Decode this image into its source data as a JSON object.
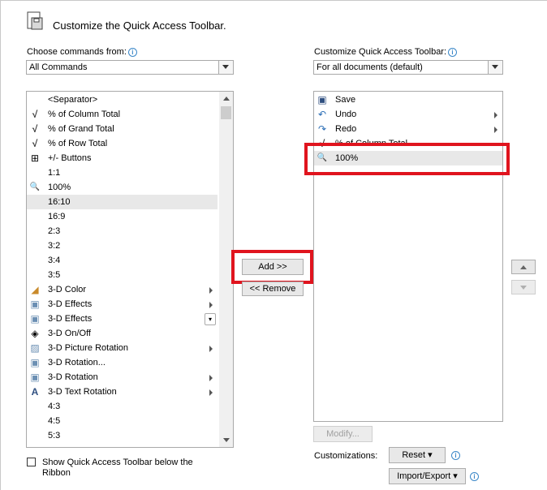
{
  "header": {
    "title": "Customize the Quick Access Toolbar."
  },
  "left_panel": {
    "label": "Choose commands from:",
    "combo_value": "All Commands",
    "items": [
      {
        "label": "<Separator>",
        "icon": "none"
      },
      {
        "label": "% of Column Total",
        "icon": "checkmark-icon"
      },
      {
        "label": "% of Grand Total",
        "icon": "checkmark-icon"
      },
      {
        "label": "% of Row Total",
        "icon": "checkmark-icon"
      },
      {
        "label": "+/- Buttons",
        "icon": "plus-minus-icon"
      },
      {
        "label": "1:1",
        "icon": "none"
      },
      {
        "label": "100%",
        "icon": "zoom-100-icon"
      },
      {
        "label": "16:10",
        "icon": "none",
        "selected": true
      },
      {
        "label": "16:9",
        "icon": "none"
      },
      {
        "label": "2:3",
        "icon": "none"
      },
      {
        "label": "3:2",
        "icon": "none"
      },
      {
        "label": "3:4",
        "icon": "none"
      },
      {
        "label": "3:5",
        "icon": "none"
      },
      {
        "label": "3-D Color",
        "icon": "paint-bucket-icon",
        "submenu": true
      },
      {
        "label": "3-D Effects",
        "icon": "cube-icon",
        "submenu": true
      },
      {
        "label": "3-D Effects",
        "icon": "cube-icon",
        "dropdown": true
      },
      {
        "label": "3-D On/Off",
        "icon": "shapes-icon"
      },
      {
        "label": "3-D Picture Rotation",
        "icon": "picture-rotate-icon",
        "submenu": true
      },
      {
        "label": "3-D Rotation...",
        "icon": "cube-icon"
      },
      {
        "label": "3-D Rotation",
        "icon": "cube-icon",
        "submenu": true
      },
      {
        "label": "3-D Text Rotation",
        "icon": "text-a-icon",
        "submenu": true
      },
      {
        "label": "4:3",
        "icon": "none"
      },
      {
        "label": "4:5",
        "icon": "none"
      },
      {
        "label": "5:3",
        "icon": "none"
      }
    ],
    "checkbox_label": "Show Quick Access Toolbar below the Ribbon"
  },
  "right_panel": {
    "label": "Customize Quick Access Toolbar:",
    "combo_value": "For all documents (default)",
    "items": [
      {
        "label": "Save",
        "icon": "floppy-icon"
      },
      {
        "label": "Undo",
        "icon": "undo-icon",
        "submenu": true
      },
      {
        "label": "Redo",
        "icon": "redo-icon",
        "submenu": true
      },
      {
        "label": "% of Column Total",
        "icon": "checkmark-icon"
      },
      {
        "label": "100%",
        "icon": "zoom-100-icon",
        "selected": true
      }
    ],
    "modify_label": "Modify...",
    "customizations_label": "Customizations:",
    "reset_label": "Reset",
    "import_export_label": "Import/Export"
  },
  "buttons": {
    "add": "Add >>",
    "remove": "<< Remove"
  },
  "colors": {
    "highlight": "#e0141e",
    "selection": "#e8e8e8",
    "info": "#3a87c8"
  }
}
